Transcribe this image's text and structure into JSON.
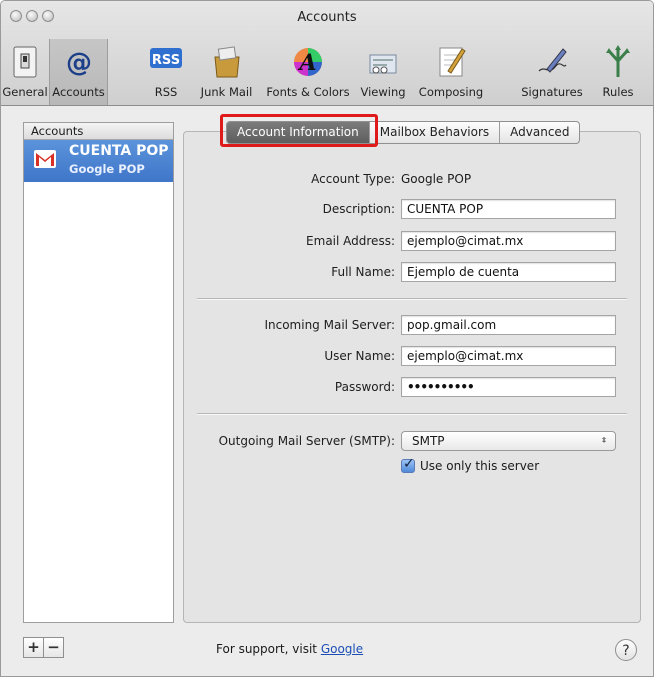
{
  "window": {
    "title": "Accounts"
  },
  "toolbar": {
    "items": [
      {
        "label": "General",
        "icon": "general-switch-icon"
      },
      {
        "label": "Accounts",
        "icon": "at-sign-icon",
        "selected": true
      },
      {
        "label": "RSS",
        "icon": "rss-icon",
        "icon_text": "RSS"
      },
      {
        "label": "Junk Mail",
        "icon": "junk-mail-icon"
      },
      {
        "label": "Fonts & Colors",
        "icon": "fonts-colors-icon",
        "icon_text": "A"
      },
      {
        "label": "Viewing",
        "icon": "viewing-icon"
      },
      {
        "label": "Composing",
        "icon": "composing-icon"
      },
      {
        "label": "Signatures",
        "icon": "signatures-icon"
      },
      {
        "label": "Rules",
        "icon": "rules-icon"
      }
    ]
  },
  "sidebar": {
    "header": "Accounts",
    "accounts": [
      {
        "name": "CUENTA POP",
        "type": "Google POP",
        "icon": "gmail-icon"
      }
    ],
    "add_label": "+",
    "remove_label": "−"
  },
  "tabs": [
    {
      "label": "Account Information",
      "active": true
    },
    {
      "label": "Mailbox Behaviors"
    },
    {
      "label": "Advanced"
    }
  ],
  "form": {
    "account_type_label": "Account Type:",
    "account_type_value": "Google POP",
    "description_label": "Description:",
    "description_value": "CUENTA POP",
    "email_label": "Email Address:",
    "email_value": "ejemplo@cimat.mx",
    "fullname_label": "Full Name:",
    "fullname_value": "Ejemplo de cuenta",
    "incoming_label": "Incoming Mail Server:",
    "incoming_value": "pop.gmail.com",
    "username_label": "User Name:",
    "username_value": "ejemplo@cimat.mx",
    "password_label": "Password:",
    "password_value": "••••••••••",
    "outgoing_label": "Outgoing Mail Server (SMTP):",
    "outgoing_value": "SMTP",
    "use_only_label": "Use only this server",
    "use_only_checked": true
  },
  "footer": {
    "support_text": "For support, visit ",
    "support_link": "Google",
    "help_label": "?"
  },
  "colors": {
    "selection": "#3f76c9",
    "highlight_box": "#e01a1a",
    "link": "#1b4fb5"
  }
}
